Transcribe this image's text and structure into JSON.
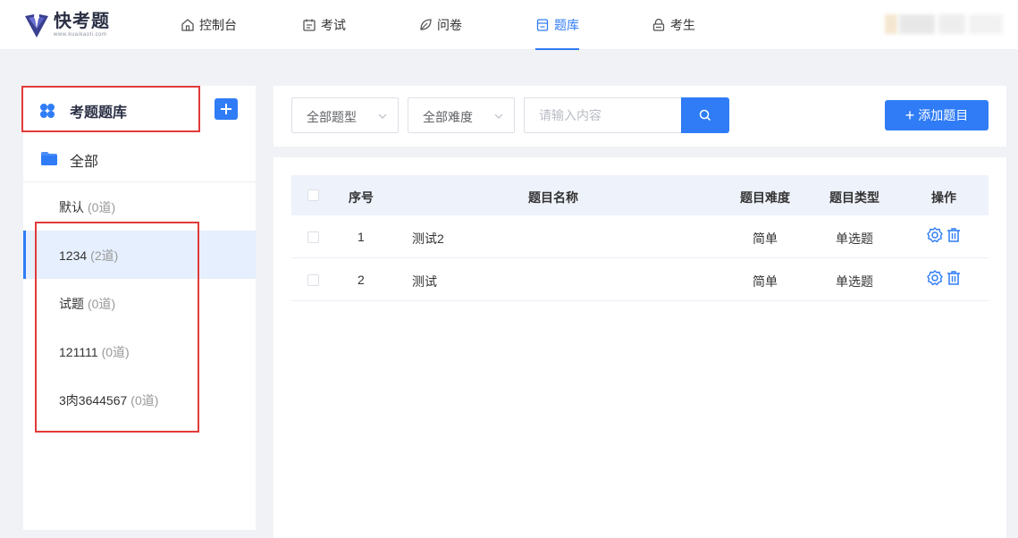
{
  "brand": {
    "name": "快考题",
    "sub": "www.kuaikaoti.com"
  },
  "nav": {
    "items": [
      {
        "label": "控制台",
        "icon": "home-icon"
      },
      {
        "label": "考试",
        "icon": "calendar-icon"
      },
      {
        "label": "问卷",
        "icon": "leaf-icon"
      },
      {
        "label": "题库",
        "icon": "book-icon",
        "active": true
      },
      {
        "label": "考生",
        "icon": "lock-user-icon"
      }
    ]
  },
  "sidebar": {
    "title": "考题题库",
    "all_label": "全部",
    "categories": [
      {
        "name": "默认",
        "count": "(0道)"
      },
      {
        "name": "1234",
        "count": "(2道)",
        "active": true
      },
      {
        "name": "试题",
        "count": "(0道)"
      },
      {
        "name": "121111",
        "count": "(0道)"
      },
      {
        "name": "3肉3644567",
        "count": "(0道)"
      }
    ]
  },
  "filters": {
    "type_select": "全部题型",
    "difficulty_select": "全部难度",
    "search_placeholder": "请输入内容",
    "add_button": "添加题目"
  },
  "table": {
    "headers": {
      "index": "序号",
      "name": "题目名称",
      "difficulty": "题目难度",
      "type": "题目类型",
      "actions": "操作"
    },
    "rows": [
      {
        "index": "1",
        "name": "测试2",
        "difficulty": "简单",
        "type": "单选题"
      },
      {
        "index": "2",
        "name": "测试",
        "difficulty": "简单",
        "type": "单选题"
      }
    ]
  },
  "colors": {
    "primary": "#2f7cf6",
    "highlight_box": "#e23a3a",
    "page_bg": "#f1f2f6",
    "active_row_bg": "#e6effd"
  }
}
